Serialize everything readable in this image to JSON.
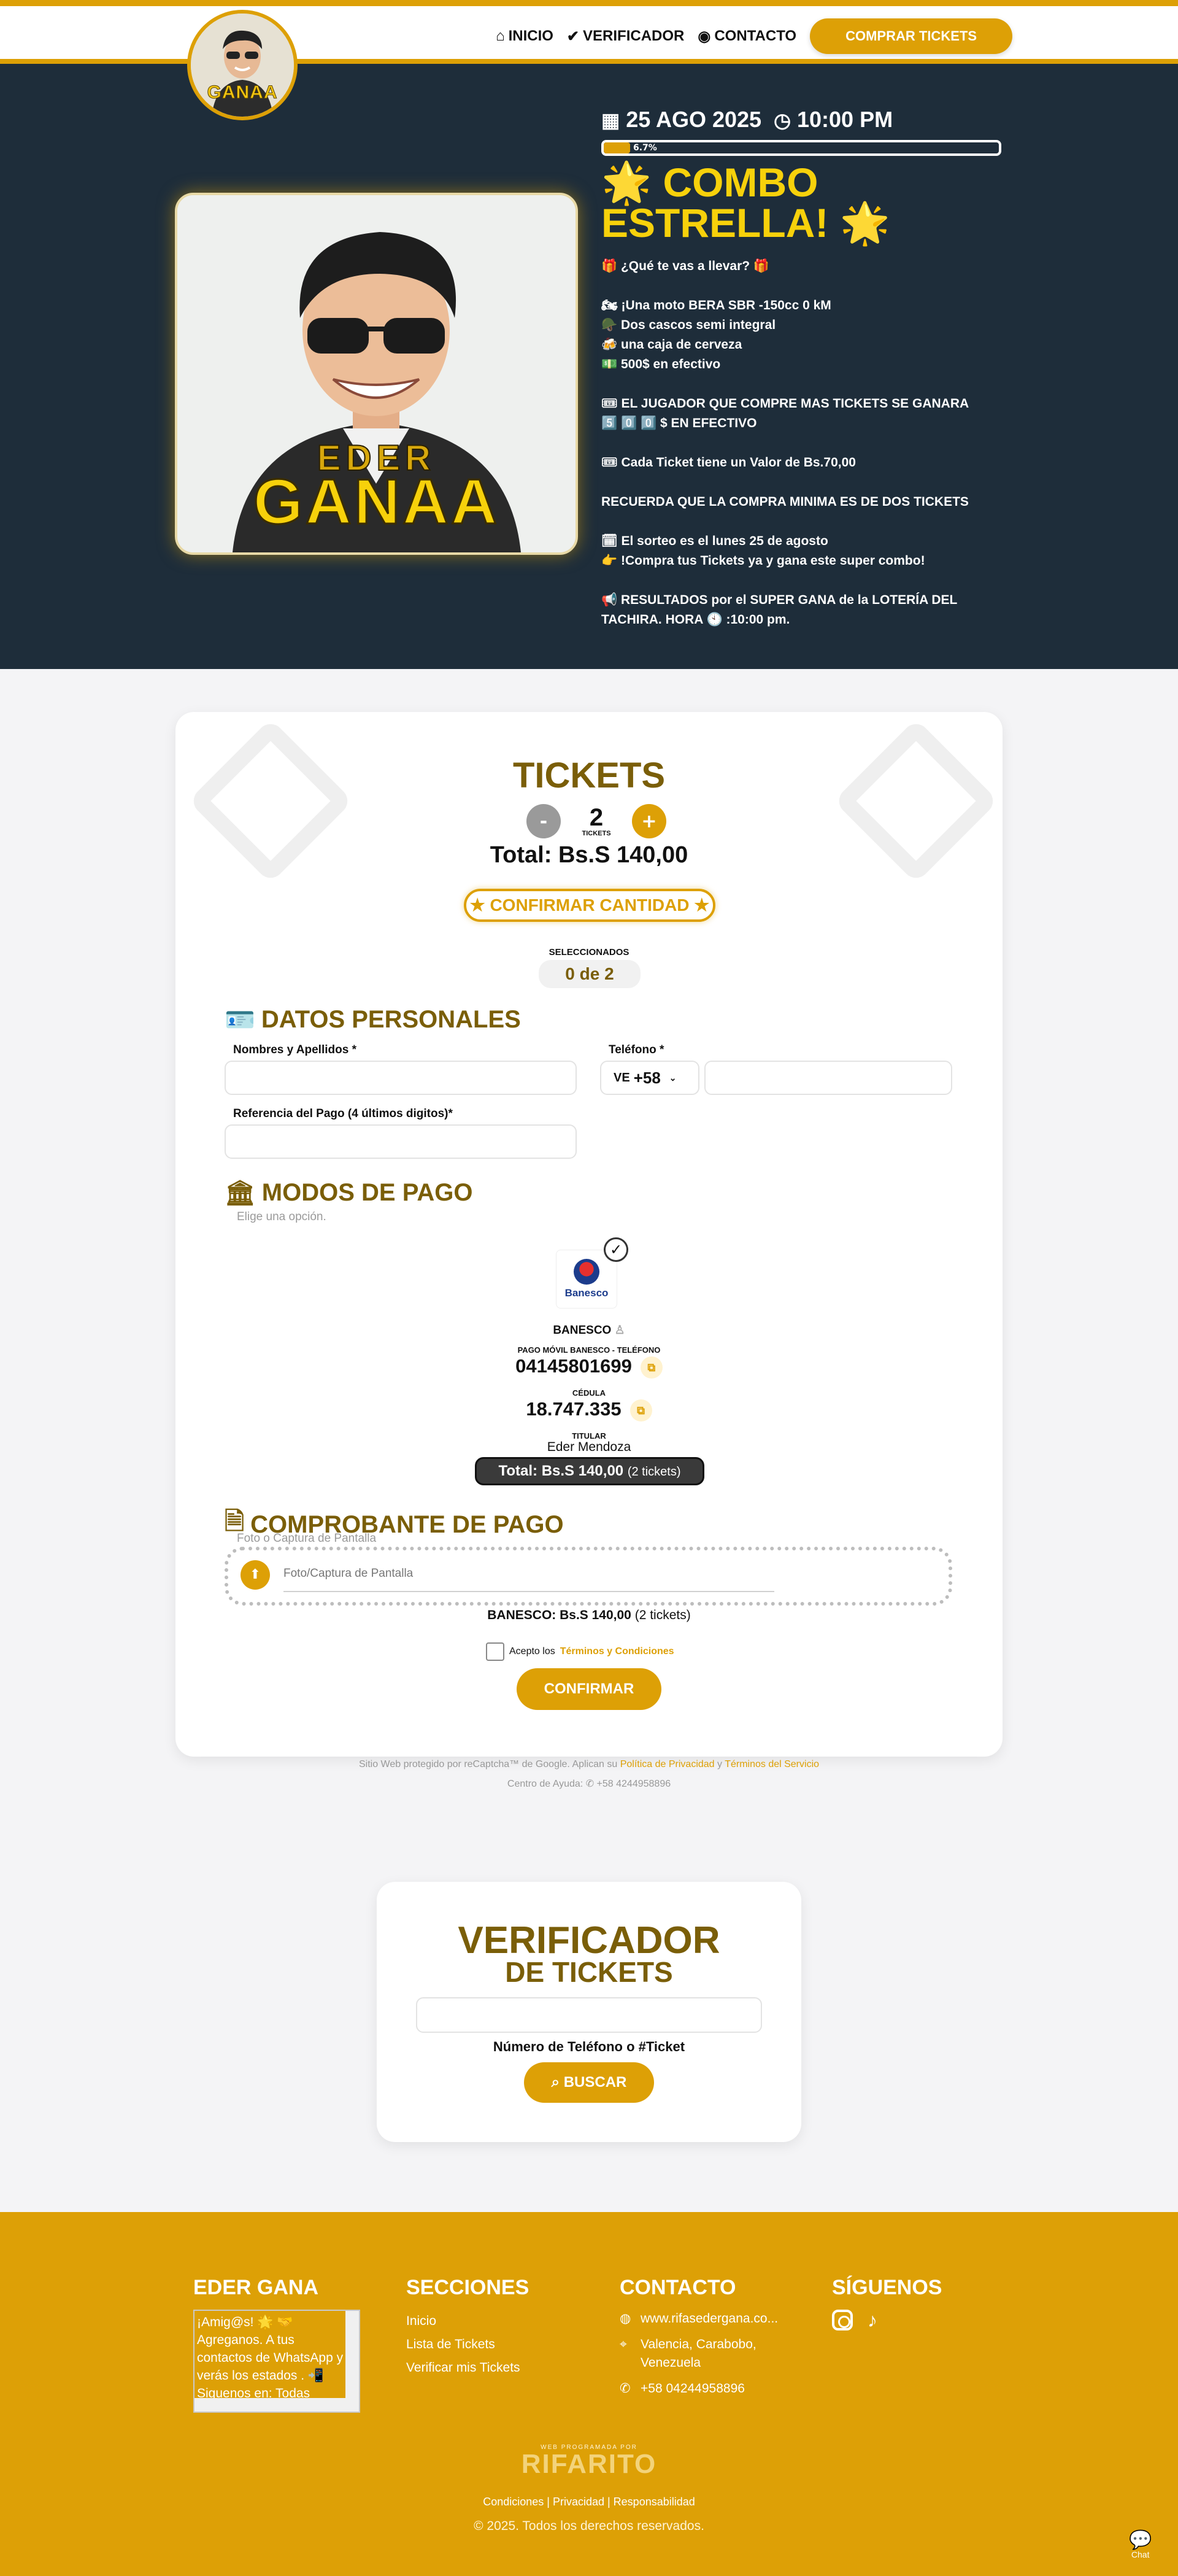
{
  "nav": {
    "brand": "GANAA",
    "items": [
      {
        "icon": "home-icon",
        "glyph": "⌂",
        "label": "INICIO"
      },
      {
        "icon": "check-circle-icon",
        "glyph": "✔",
        "label": "VERIFICADOR"
      },
      {
        "icon": "user-circle-icon",
        "glyph": "◉",
        "label": "CONTACTO"
      }
    ],
    "buy_label": "COMPRAR TICKETS"
  },
  "hero": {
    "brand_top": "EDER",
    "brand_bottom": "GANAA",
    "date": "25 AGO 2025",
    "time": "10:00 PM",
    "progress_pct": 6.7,
    "progress_label": "6.7%",
    "title_line1": "🌟 COMBO",
    "title_line2": "ESTRELLA! 🌟",
    "lines": [
      "🎁 ¿Qué te vas a llevar? 🎁",
      "",
      "🏍 ¡Una moto BERA SBR -150cc  0 kM",
      "🪖 Dos cascos semi integral",
      "🍻 una caja de cerveza",
      "💵 500$ en efectivo",
      "",
      "🎟 EL JUGADOR QUE COMPRE MAS TICKETS SE GANARA",
      "5️⃣ 0️⃣ 0️⃣ $ EN EFECTIVO",
      "",
      "🎟 Cada Ticket tiene un Valor de Bs.70,00",
      "",
      "RECUERDA QUE LA COMPRA MINIMA ES DE DOS TICKETS",
      "",
      "🗓 El  sorteo es  el lunes 25 de agosto",
      "👉 !Compra tus Tickets ya y gana este super combo!",
      "",
      "📢 RESULTADOS por el SUPER GANA de la  LOTERÍA DEL TACHIRA. HORA  🕙 :10:00 pm."
    ]
  },
  "tickets": {
    "title": "TICKETS",
    "minus": "-",
    "plus": "+",
    "quantity": "2",
    "quantity_unit": "TICKETS",
    "total": "Total: Bs.S 140,00",
    "confirm_label": "CONFIRMAR CANTIDAD",
    "selected_label": "SELECCIONADOS",
    "selected_value": "0 de 2"
  },
  "personal": {
    "title": "DATOS PERSONALES",
    "name_label": "Nombres y Apellidos *",
    "phone_label": "Teléfono *",
    "country_code": "VE",
    "dial_code": "+58",
    "ref_label": "Referencia del Pago (4 últimos digitos)*"
  },
  "payment": {
    "title": "MODOS DE PAGO",
    "hint": "Elige una opción.",
    "bank_logo_text": "Banesco",
    "bank_name": "BANESCO",
    "mobile_label": "PAGO MÓVIL BANESCO - TELÉFONO",
    "mobile_number": "04145801699",
    "id_label": "CÉDULA",
    "id_number": "18.747.335",
    "holder_label": "TITULAR",
    "holder_name": "Eder Mendoza",
    "total": "Total: Bs.S 140,00",
    "total_tickets": "(2 tickets)"
  },
  "receipt": {
    "title": "COMPROBANTE DE PAGO",
    "hint": "Foto o Captura de Pantalla",
    "field_placeholder": "Foto/Captura de Pantalla",
    "summary": "BANESCO: Bs.S 140,00",
    "summary_tickets": "(2 tickets)",
    "terms_prefix": "Acepto los",
    "terms_link": "Términos y Condiciones",
    "confirm_label": "CONFIRMAR"
  },
  "recaptcha": {
    "text": "Sitio Web protegido por reCaptcha™ de Google. Aplican su",
    "privacy": "Política de Privacidad",
    "and": "y",
    "terms": "Términos del Servicio",
    "help": "Centro de Ayuda: ✆ +58 4244958896"
  },
  "verifier": {
    "title1": "VERIFICADOR",
    "title2": "DE TICKETS",
    "input_label": "Número de Teléfono o #Ticket",
    "button": "BUSCAR"
  },
  "footer": {
    "col1_title": "EDER GANA",
    "col1_text": "¡Amig@s! 🌟 🤝 Agreganos. A tus contactos de WhatsApp y verás los estados . 📲 Siguenos en: Todas",
    "col2_title": "SECCIONES",
    "sections": [
      "Inicio",
      "Lista de Tickets",
      "Verificar mis Tickets"
    ],
    "col3_title": "CONTACTO",
    "website": "www.rifasedergana.co...",
    "location": "Valencia, Carabobo, Venezuela",
    "phone": "+58 04244958896",
    "col4_title": "SÍGUENOS",
    "powered": "WEB PROGRAMADA POR",
    "powered_brand": "RIFARITO",
    "links": "Condiciones | Privacidad | Responsabilidad",
    "copyright": "© 2025. Todos los derechos reservados.",
    "chat": "Chat"
  },
  "colors": {
    "accent": "#DDA006",
    "hero_bg": "#1e2d3a",
    "title_brown": "#7a5e08",
    "highlight_yellow": "#f7d10b"
  }
}
